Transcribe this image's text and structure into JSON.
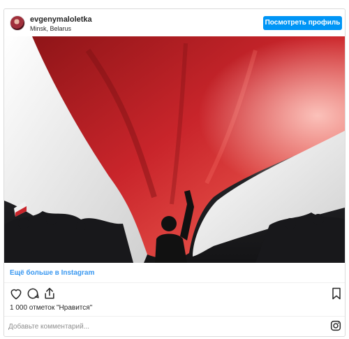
{
  "header": {
    "username": "evgenymaloletka",
    "location": "Minsk, Belarus",
    "profile_button": "Посмотреть профиль"
  },
  "photo": {
    "description_icon": "photo"
  },
  "footer": {
    "more_link": "Ещё больше в Instagram",
    "likes": "1 000 отметок \"Нравится\"",
    "comment_placeholder": "Добавьте комментарий..."
  },
  "icons": [
    "heart-icon",
    "comment-icon",
    "share-icon",
    "bookmark-icon",
    "instagram-icon"
  ],
  "colors": {
    "accent": "#0095f6",
    "link": "#3897f0",
    "border": "#dbdbdb",
    "flag_red": "#c9252b",
    "flag_white": "#f2f2f2"
  }
}
